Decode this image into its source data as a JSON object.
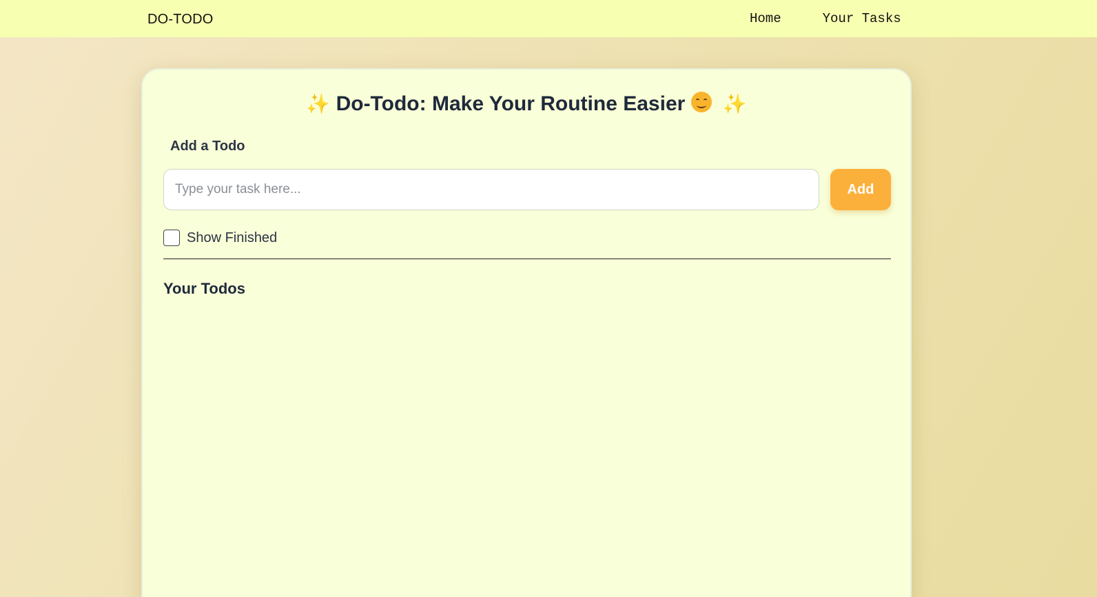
{
  "navbar": {
    "brand": "DO-TODO",
    "links": [
      {
        "label": "Home"
      },
      {
        "label": "Your Tasks"
      }
    ]
  },
  "card": {
    "title_prefix_icon": "sparkles-icon",
    "title": "Do-Todo: Make Your Routine Easier",
    "title_emoji_icon": "smiling-face-icon",
    "title_suffix_icon": "sparkles-icon",
    "add_section_label": "Add a Todo",
    "task_input": {
      "placeholder": "Type your task here...",
      "value": ""
    },
    "add_button_label": "Add",
    "show_finished": {
      "label": "Show Finished",
      "checked": false
    },
    "todos_heading": "Your Todos",
    "todos": []
  },
  "colors": {
    "navbar_bg": "#f7ffb1",
    "card_bg": "#f9ffd8",
    "accent": "#fbb03b",
    "text_dark": "#1e293b"
  }
}
